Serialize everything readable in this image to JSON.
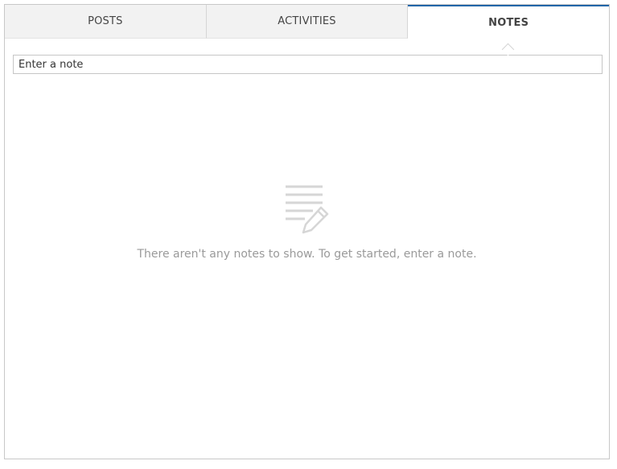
{
  "tabs": [
    {
      "label": "POSTS",
      "active": false
    },
    {
      "label": "ACTIVITIES",
      "active": false
    },
    {
      "label": "NOTES",
      "active": true
    }
  ],
  "note_input": {
    "placeholder": "Enter a note",
    "value": ""
  },
  "empty_state": {
    "icon": "notes-pencil-icon",
    "message": "There aren't any notes to show. To get started, enter a note."
  },
  "colors": {
    "active_tab_accent": "#2266a8",
    "inactive_tab_bg": "#f2f2f2",
    "empty_text": "#9a9a9a",
    "icon": "#d6d6d6"
  }
}
